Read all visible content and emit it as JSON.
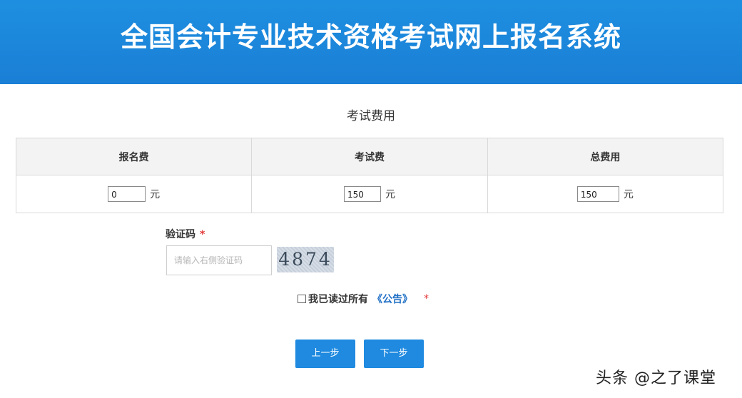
{
  "header": {
    "title": "全国会计专业技术资格考试网上报名系统"
  },
  "fees": {
    "section_title": "考试费用",
    "columns": [
      "报名费",
      "考试费",
      "总费用"
    ],
    "values": [
      "0",
      "150",
      "150"
    ],
    "unit": "元"
  },
  "captcha": {
    "label": "验证码",
    "required_mark": "*",
    "placeholder": "请输入右侧验证码",
    "code": "4874"
  },
  "agreement": {
    "text": "我已读过所有",
    "link_text": "《公告》",
    "required_mark": "*"
  },
  "buttons": {
    "prev_label": "上一步",
    "next_label": "下一步"
  },
  "watermark": {
    "text": "头条 @之了课堂"
  }
}
